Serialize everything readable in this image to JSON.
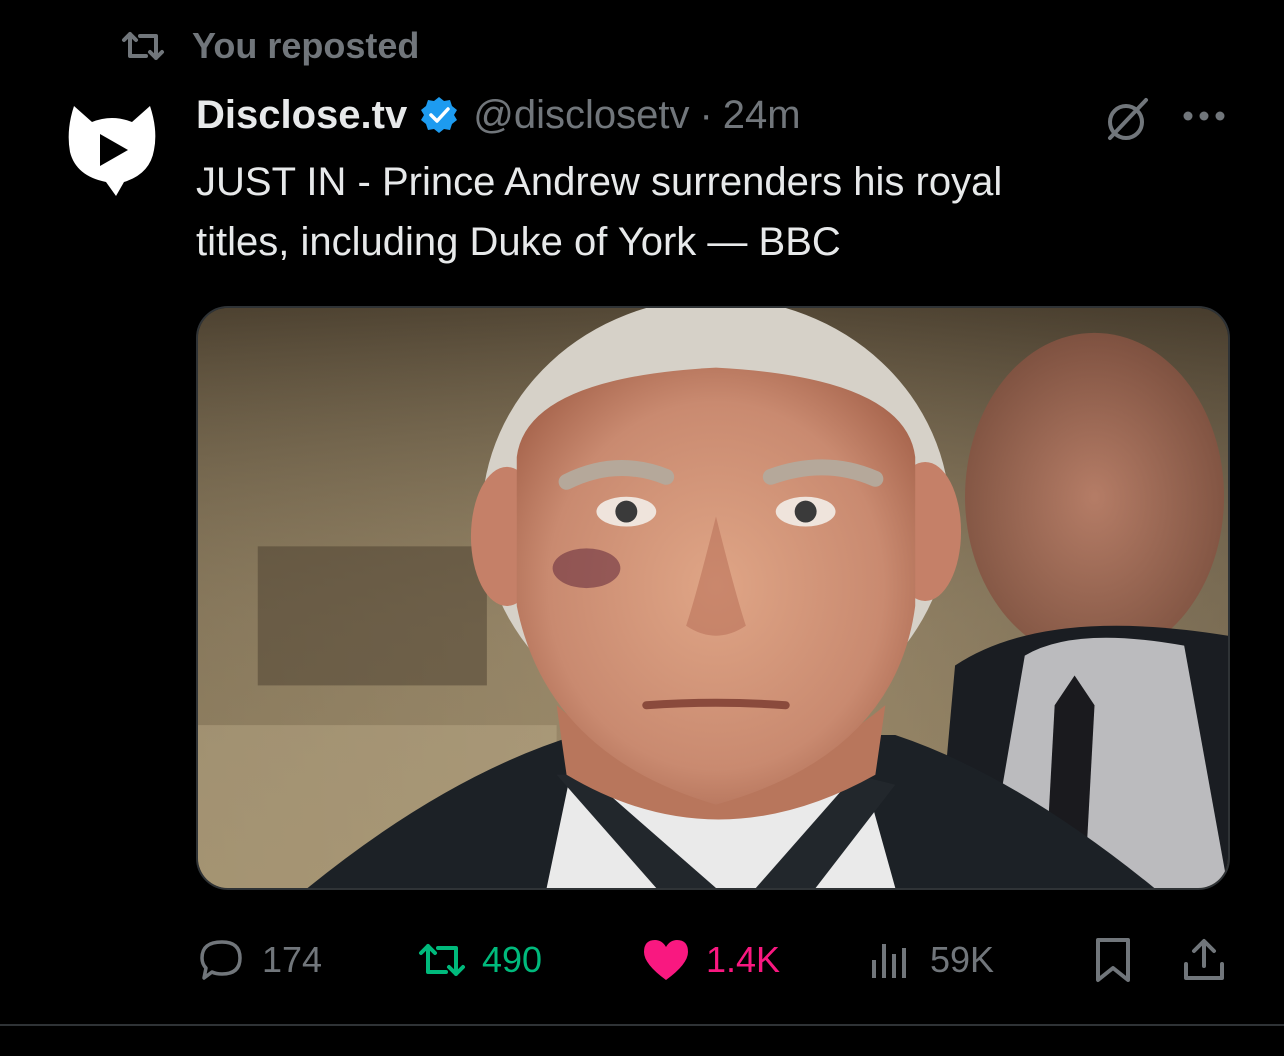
{
  "social_context": {
    "text": "You reposted",
    "icon": "repost-icon"
  },
  "author": {
    "display_name": "Disclose.tv",
    "handle": "@disclosetv",
    "separator": "·",
    "time": "24m",
    "verified": true,
    "avatar_icon": "disclose-logo-icon"
  },
  "tweet": {
    "text_line1": "JUST IN - Prince Andrew surrenders his royal",
    "text_line2": "titles, including Duke of York — BBC"
  },
  "actions": {
    "replies": "174",
    "reposts": "490",
    "likes": "1.4K",
    "views": "59K"
  },
  "colors": {
    "background": "#000000",
    "text": "#e7e9ea",
    "muted": "#71767b",
    "verified": "#1d9bf0",
    "repost_active": "#00ba7c",
    "like_active": "#f91880",
    "divider": "#2f3336"
  }
}
